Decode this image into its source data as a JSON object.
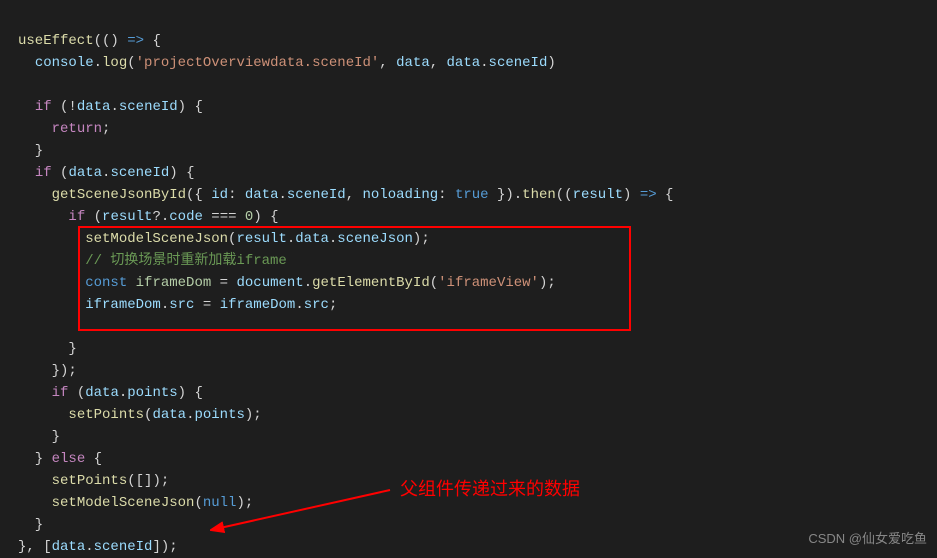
{
  "code": {
    "l1_a": "useEffect",
    "l1_b": "(()",
    "l1_c": " => ",
    "l1_d": "{",
    "l2_a": "  ",
    "l2_b": "console",
    "l2_c": ".",
    "l2_d": "log",
    "l2_e": "(",
    "l2_f": "'projectOverviewdata.sceneId'",
    "l2_g": ", ",
    "l2_h": "data",
    "l2_i": ", ",
    "l2_j": "data",
    "l2_k": ".",
    "l2_l": "sceneId",
    "l2_m": ")",
    "l3": " ",
    "l4_a": "  ",
    "l4_b": "if",
    "l4_c": " (!",
    "l4_d": "data",
    "l4_e": ".",
    "l4_f": "sceneId",
    "l4_g": ") {",
    "l5_a": "    ",
    "l5_b": "return",
    "l5_c": ";",
    "l6": "  }",
    "l7_a": "  ",
    "l7_b": "if",
    "l7_c": " (",
    "l7_d": "data",
    "l7_e": ".",
    "l7_f": "sceneId",
    "l7_g": ") {",
    "l8_a": "    ",
    "l8_b": "getSceneJsonById",
    "l8_c": "({ ",
    "l8_d": "id",
    "l8_e": ": ",
    "l8_f": "data",
    "l8_g": ".",
    "l8_h": "sceneId",
    "l8_i": ", ",
    "l8_j": "noloading",
    "l8_k": ": ",
    "l8_l": "true",
    "l8_m": " }).",
    "l8_n": "then",
    "l8_o": "((",
    "l8_p": "result",
    "l8_q": ")",
    "l8_r": " => ",
    "l8_s": "{",
    "l9_a": "      ",
    "l9_b": "if",
    "l9_c": " (",
    "l9_d": "result",
    "l9_e": "?.",
    "l9_f": "code",
    "l9_g": " === ",
    "l9_h": "0",
    "l9_i": ") {",
    "l10_a": "        ",
    "l10_b": "setModelSceneJson",
    "l10_c": "(",
    "l10_d": "result",
    "l10_e": ".",
    "l10_f": "data",
    "l10_g": ".",
    "l10_h": "sceneJson",
    "l10_i": ");",
    "l11_a": "        ",
    "l11_b": "// 切换场景时重新加载iframe",
    "l12_a": "        ",
    "l12_b": "const",
    "l12_c": " ",
    "l12_d": "iframeDom",
    "l12_e": " = ",
    "l12_f": "document",
    "l12_g": ".",
    "l12_h": "getElementById",
    "l12_i": "(",
    "l12_j": "'iframeView'",
    "l12_k": ");",
    "l13_a": "        ",
    "l13_b": "iframeDom",
    "l13_c": ".",
    "l13_d": "src",
    "l13_e": " = ",
    "l13_f": "iframeDom",
    "l13_g": ".",
    "l13_h": "src",
    "l13_i": ";",
    "l14": " ",
    "l15": "      }",
    "l16": "    });",
    "l17_a": "    ",
    "l17_b": "if",
    "l17_c": " (",
    "l17_d": "data",
    "l17_e": ".",
    "l17_f": "points",
    "l17_g": ") {",
    "l18_a": "      ",
    "l18_b": "setPoints",
    "l18_c": "(",
    "l18_d": "data",
    "l18_e": ".",
    "l18_f": "points",
    "l18_g": ");",
    "l19": "    }",
    "l20_a": "  } ",
    "l20_b": "else",
    "l20_c": " {",
    "l21_a": "    ",
    "l21_b": "setPoints",
    "l21_c": "([]);",
    "l22_a": "    ",
    "l22_b": "setModelSceneJson",
    "l22_c": "(",
    "l22_d": "null",
    "l22_e": ");",
    "l23": "  }",
    "l24_a": "}, [",
    "l24_b": "data",
    "l24_c": ".",
    "l24_d": "sceneId",
    "l24_e": "]);"
  },
  "annotation": "父组件传递过来的数据",
  "watermark": "CSDN @仙女爱吃鱼"
}
